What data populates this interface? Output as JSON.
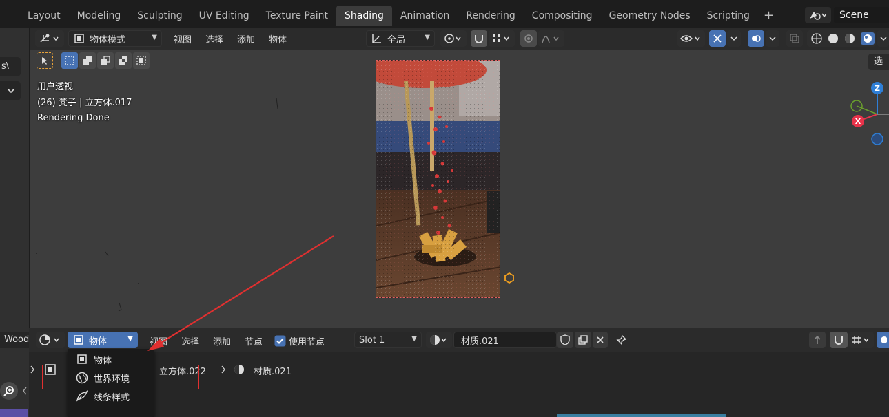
{
  "workspace_tabs": [
    {
      "label": "Layout"
    },
    {
      "label": "Modeling"
    },
    {
      "label": "Sculpting"
    },
    {
      "label": "UV Editing"
    },
    {
      "label": "Texture Paint"
    },
    {
      "label": "Shading",
      "active": true
    },
    {
      "label": "Animation"
    },
    {
      "label": "Rendering"
    },
    {
      "label": "Compositing"
    },
    {
      "label": "Geometry Nodes"
    },
    {
      "label": "Scripting"
    }
  ],
  "add_workspace": "+",
  "scene": {
    "name": "Scene"
  },
  "left_strip": {
    "field1": "s\\",
    "field2_chevron": "⌄"
  },
  "viewport_header": {
    "mode": "物体模式",
    "menus": [
      "视图",
      "选择",
      "添加",
      "物体"
    ],
    "transform_orientation": "全局",
    "corner_tab": "选"
  },
  "viewport_overlay": {
    "view_name": "用户透视",
    "object_info": "(26) 凳子 | 立方体.017",
    "status": "Rendering Done"
  },
  "gizmo": {
    "z": "Z",
    "x": "X"
  },
  "shader_header": {
    "left_label": "Wood",
    "type": "物体",
    "menus": [
      "视图",
      "选择",
      "添加",
      "节点"
    ],
    "use_nodes_label": "使用节点",
    "use_nodes_checked": true,
    "slot": "Slot 1",
    "material": "材质.021"
  },
  "breadcrumb": {
    "object": "立方体.022",
    "separator": ">",
    "material": "材质.021"
  },
  "dropdown_menu": [
    {
      "label": "物体",
      "icon": "cube-icon"
    },
    {
      "label": "世界环境",
      "icon": "world-icon",
      "highlighted": true
    },
    {
      "label": "线条样式",
      "icon": "linestyle-icon"
    }
  ],
  "colors": {
    "accent": "#4772b3",
    "active_tab": "#3b3b3b",
    "annotation": "#e03030",
    "gizmo_x": "#e8334a",
    "gizmo_y": "#6aa02c",
    "gizmo_z": "#2f7fd6"
  }
}
